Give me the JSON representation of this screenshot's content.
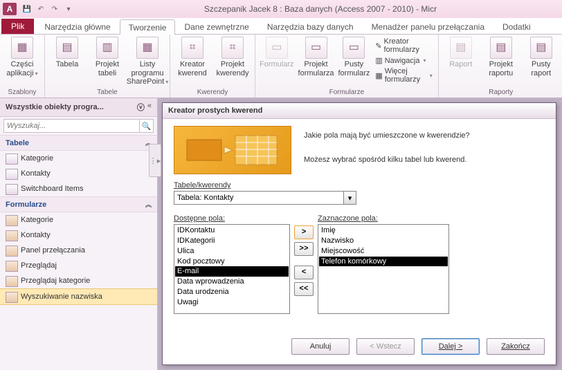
{
  "app_icon_letter": "A",
  "title": "Szczepanik Jacek 8 : Baza danych (Access 2007 - 2010)  -  Micr",
  "file_tab": "Plik",
  "tabs": [
    "Narzędzia główne",
    "Tworzenie",
    "Dane zewnętrzne",
    "Narzędzia bazy danych",
    "Menadżer panelu przełączania",
    "Dodatki"
  ],
  "active_tab_index": 1,
  "ribbon": {
    "szablony": {
      "label": "Szablony",
      "czesci": "Części aplikacji"
    },
    "tabele": {
      "label": "Tabele",
      "tabela": "Tabela",
      "projekt": "Projekt tabeli",
      "share": "Listy programu SharePoint"
    },
    "kwerendy": {
      "label": "Kwerendy",
      "kreator": "Kreator kwerend",
      "projekt": "Projekt kwerendy"
    },
    "formularze": {
      "label": "Formularze",
      "formularz": "Formularz",
      "projekt": "Projekt formularza",
      "pusty": "Pusty formularz",
      "kreator": "Kreator formularzy",
      "nawig": "Nawigacja",
      "wiecej": "Więcej formularzy"
    },
    "raporty": {
      "label": "Raporty",
      "raport": "Raport",
      "projekt": "Projekt raportu",
      "pusty": "Pusty raport"
    }
  },
  "nav": {
    "header": "Wszystkie obiekty progra...",
    "search_placeholder": "Wyszukaj...",
    "cat_tabele": "Tabele",
    "cat_formularze": "Formularze",
    "tabele": [
      "Kategorie",
      "Kontakty",
      "Switchboard Items"
    ],
    "formularze": [
      "Kategorie",
      "Kontakty",
      "Panel przełączania",
      "Przeglądaj",
      "Przeglądaj kategorie",
      "Wyszukiwanie nazwiska"
    ],
    "selected": "Wyszukiwanie nazwiska"
  },
  "dialog": {
    "title": "Kreator prostych kwerend",
    "q1": "Jakie pola mają być umieszczone w kwerendzie?",
    "q2": "Możesz wybrać spośród kilku tabel lub kwerend.",
    "tabele_label": "Tabele/kwerendy",
    "combo_value": "Tabela: Kontakty",
    "avail_label": "Dostępne pola:",
    "sel_label": "Zaznaczone pola:",
    "available": [
      "IDKontaktu",
      "IDKategorii",
      "Ulica",
      "Kod pocztowy",
      "E-mail",
      "Data wprowadzenia",
      "Data urodzenia",
      "Uwagi"
    ],
    "available_hl_index": 4,
    "selected": [
      "Imię",
      "Nazwisko",
      "Miejscowość",
      "Telefon komórkowy"
    ],
    "selected_hl_index": 3,
    "btn_add": ">",
    "btn_addall": ">>",
    "btn_rem": "<",
    "btn_remall": "<<",
    "btn_cancel": "Anuluj",
    "btn_back": "< Wstecz",
    "btn_next": "Dalej >",
    "btn_finish": "Zakończ"
  }
}
